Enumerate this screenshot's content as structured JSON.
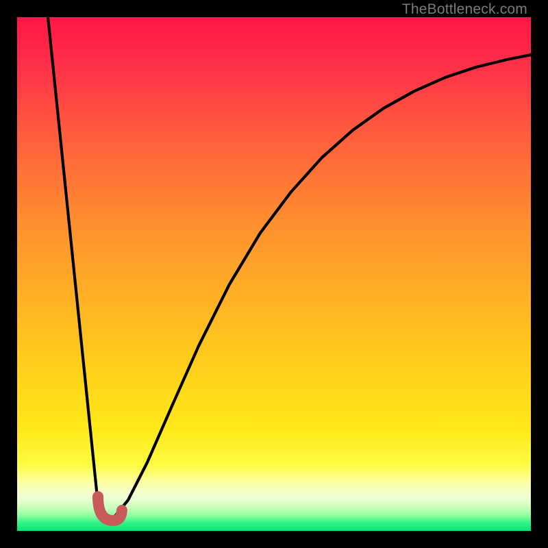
{
  "watermark": "TheBottleneck.com",
  "chart_data": {
    "type": "line",
    "title": "",
    "xlabel": "",
    "ylabel": "",
    "xlim": [
      0,
      100
    ],
    "ylim": [
      0,
      100
    ],
    "series": [
      {
        "name": "bottleneck-curve",
        "x": [
          6,
          16,
          19,
          22,
          25,
          30,
          35,
          41,
          47,
          53,
          59,
          65,
          71,
          77,
          83,
          89,
          95,
          100
        ],
        "y": [
          100,
          2.7,
          2.4,
          6,
          13,
          24,
          36,
          48,
          58,
          66,
          73,
          78,
          82,
          86,
          88,
          90,
          92,
          93
        ]
      }
    ],
    "annotations": [
      {
        "name": "optimal-zone",
        "x_range": [
          15.5,
          20.5
        ],
        "y_range": [
          2,
          7
        ],
        "color": "#c85a5a"
      }
    ],
    "background_gradient": {
      "direction": "vertical",
      "stops": [
        {
          "pos": 0.0,
          "color": "#ff1744"
        },
        {
          "pos": 0.4,
          "color": "#ff8f2f"
        },
        {
          "pos": 0.7,
          "color": "#ffd31a"
        },
        {
          "pos": 0.9,
          "color": "#fcffaf"
        },
        {
          "pos": 1.0,
          "color": "#00e676"
        }
      ]
    },
    "grid": false,
    "legend": false
  }
}
